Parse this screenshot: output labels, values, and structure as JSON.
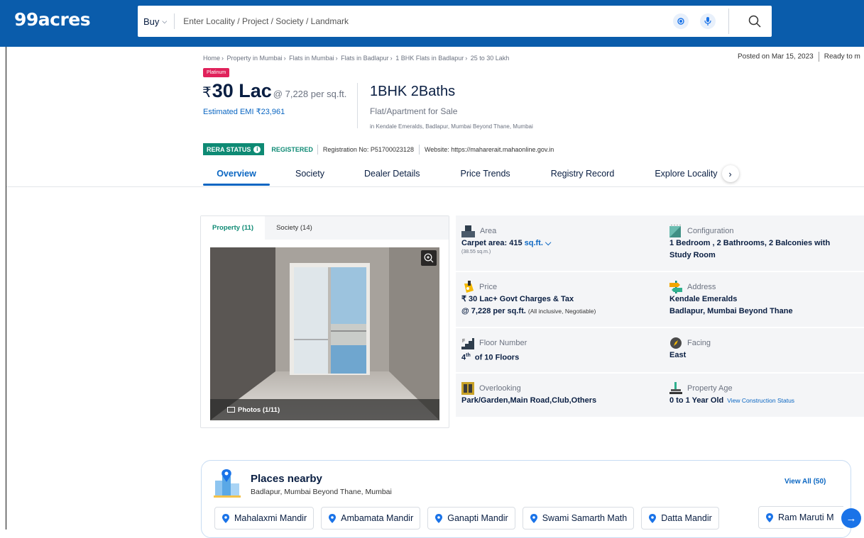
{
  "header": {
    "logo": "99acres",
    "buy_label": "Buy",
    "search_placeholder": "Enter Locality / Project / Society / Landmark"
  },
  "breadcrumb": [
    "Home",
    "Property in Mumbai",
    "Flats in Mumbai",
    "Flats in Badlapur",
    "1 BHK Flats in Badlapur",
    "25 to 30 Lakh"
  ],
  "posted": {
    "date": "Posted on Mar 15, 2023",
    "status": "Ready to m"
  },
  "listing": {
    "badge": "Platinum",
    "rupee": "₹",
    "price": "30 Lac",
    "per_sqft": "@ 7,228 per sq.ft.",
    "emi": "Estimated EMI ₹23,961",
    "title": "1BHK 2Baths",
    "type": "Flat/Apartment for Sale",
    "location": "in Kendale Emeralds, Badlapur, Mumbai Beyond Thane, Mumbai"
  },
  "rera": {
    "status_label": "RERA STATUS",
    "status": "REGISTERED",
    "registration": "Registration No: P51700023128",
    "website": "Website: https://maharerait.mahaonline.gov.in"
  },
  "tabs": [
    "Overview",
    "Society",
    "Dealer Details",
    "Price Trends",
    "Registry Record",
    "Explore Locality"
  ],
  "gallery": {
    "tabs": [
      "Property (11)",
      "Society (14)"
    ],
    "photos_label": "Photos (1/11)"
  },
  "details": {
    "area": {
      "label": "Area",
      "value": "Carpet area: 415",
      "unit": "sq.ft.",
      "sub": "(38.55 sq.m.)"
    },
    "configuration": {
      "label": "Configuration",
      "line1": "1 Bedroom , 2 Bathrooms, 2 Balconies with",
      "line2": "Study Room"
    },
    "price": {
      "label": "Price",
      "line1": "₹ 30 Lac+ Govt Charges & Tax",
      "line2": "@ 7,228 per sq.ft.",
      "note": "(All inclusive, Negotiable)"
    },
    "address": {
      "label": "Address",
      "line1": "Kendale Emeralds",
      "line2": "Badlapur, Mumbai Beyond Thane"
    },
    "floor": {
      "label": "Floor Number",
      "num": "4",
      "sup": "th",
      "rest": "of 10 Floors"
    },
    "facing": {
      "label": "Facing",
      "value": "East"
    },
    "overlooking": {
      "label": "Overlooking",
      "value": "Park/Garden,Main Road,Club,Others"
    },
    "age": {
      "label": "Property Age",
      "value": "0 to 1 Year Old",
      "link": "View Construction Status"
    }
  },
  "places": {
    "title": "Places nearby",
    "location": "Badlapur, Mumbai Beyond Thane, Mumbai",
    "view_all": "View All (50)",
    "chips": [
      "Mahalaxmi Mandir",
      "Ambamata Mandir",
      "Ganapti Mandir",
      "Swami Samarth Math",
      "Datta Mandir",
      "Ram Maruti M"
    ]
  },
  "colors": {
    "header_blue": "#0a5cab",
    "link_blue": "#0a66c2",
    "rera_green": "#0e8a74",
    "platinum_pink": "#e0225b"
  }
}
